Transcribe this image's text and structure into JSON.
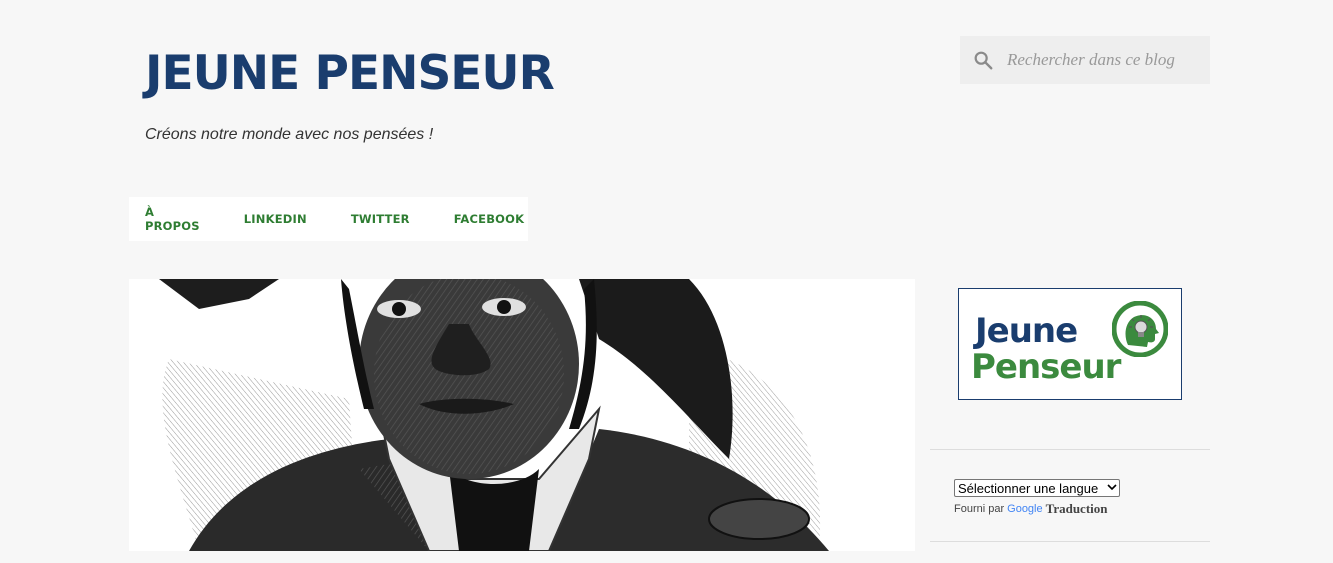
{
  "header": {
    "title": "JEUNE PENSEUR",
    "tagline": "Créons notre monde avec nos pensées !"
  },
  "search": {
    "placeholder": "Rechercher dans ce blog",
    "icon": "search-icon"
  },
  "nav": {
    "items": [
      {
        "label": "À PROPOS"
      },
      {
        "label": "LINKEDIN"
      },
      {
        "label": "TWITTER"
      },
      {
        "label": "FACEBOOK"
      }
    ]
  },
  "sidebar": {
    "logo": {
      "line1": "Jeune",
      "line2": "Penseur"
    },
    "translate": {
      "select_label": "Sélectionner une langue",
      "powered_by": "Fourni par",
      "google": "Google",
      "translate_word": "Traduction"
    }
  },
  "colors": {
    "title": "#1a3d6e",
    "nav": "#2e7d32",
    "logo_green": "#3b8a3e"
  }
}
